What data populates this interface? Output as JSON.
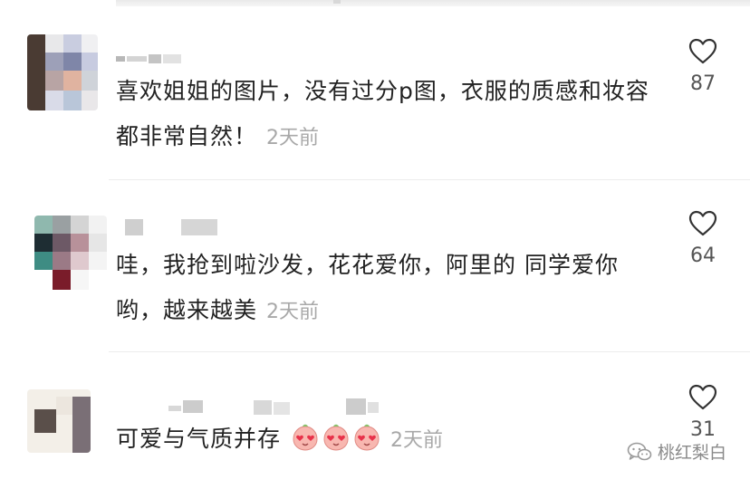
{
  "comments": [
    {
      "text": "喜欢姐姐的图片，没有过分p图，衣服的质感和妆容都非常自然！",
      "time": "2天前",
      "likes": "87",
      "emoji_count": 0
    },
    {
      "text": "哇，我抢到啦沙发，花花爱你，阿里的 同学爱你哟，越来越美",
      "time": "2天前",
      "likes": "64",
      "emoji_count": 0
    },
    {
      "text": "可爱与气质并存",
      "time": "2天前",
      "likes": "31",
      "emoji_count": 3
    }
  ],
  "watermark": "桃红梨白",
  "icons": {
    "like": "heart-outline-icon",
    "emoji": "peach-heart-eyes-emoji-icon",
    "watermark": "wechat-icon"
  },
  "colors": {
    "text": "#222222",
    "time": "#a8a8a8",
    "like_count": "#555555",
    "divider": "#ececec",
    "heart_stroke": "#333333"
  }
}
